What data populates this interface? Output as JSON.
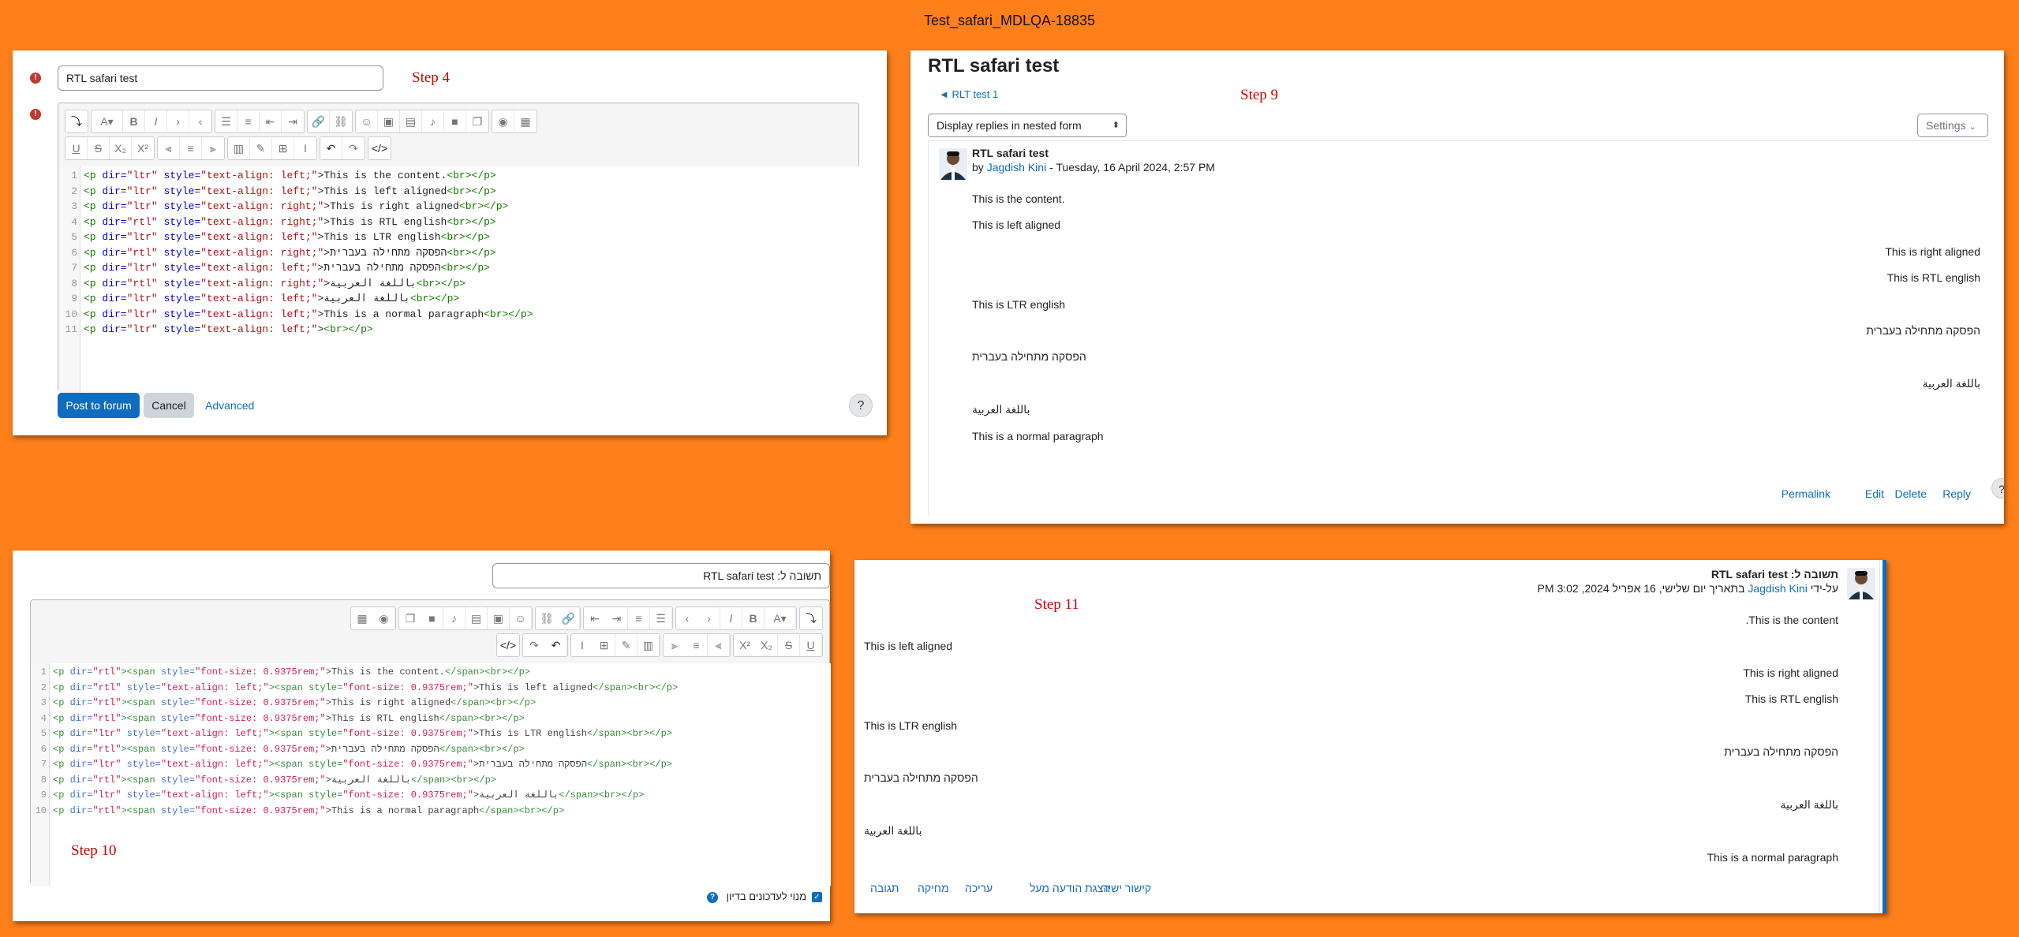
{
  "page_title": "Test_safari_MDLQA-18835",
  "steps": {
    "s4": "Step 4",
    "s9": "Step 9",
    "s10": "Step 10",
    "s11": "Step 11"
  },
  "panel1": {
    "subject_value": "RTL safari test",
    "code_lines": [
      [
        "<p ",
        "dir=",
        "\"ltr\"",
        " style=",
        "\"text-align: left;\"",
        ">This is the content.",
        "<br></p>"
      ],
      [
        "<p ",
        "dir=",
        "\"ltr\"",
        " style=",
        "\"text-align: left;\"",
        ">This is left aligned",
        "<br></p>"
      ],
      [
        "<p ",
        "dir=",
        "\"ltr\"",
        " style=",
        "\"text-align: right;\"",
        ">This is right aligned",
        "<br></p>"
      ],
      [
        "<p ",
        "dir=",
        "\"rtl\"",
        " style=",
        "\"text-align: right;\"",
        ">This is RTL english",
        "<br></p>"
      ],
      [
        "<p ",
        "dir=",
        "\"ltr\"",
        " style=",
        "\"text-align: left;\"",
        ">This is LTR english",
        "<br></p>"
      ],
      [
        "<p ",
        "dir=",
        "\"rtl\"",
        " style=",
        "\"text-align: right;\"",
        ">הפסקה מתחילה בעברית",
        "<br></p>"
      ],
      [
        "<p ",
        "dir=",
        "\"ltr\"",
        " style=",
        "\"text-align: left;\"",
        ">הפסקה מתחילה בעברית",
        "<br></p>"
      ],
      [
        "<p ",
        "dir=",
        "\"rtl\"",
        " style=",
        "\"text-align: right;\"",
        ">باللغة العربية",
        "<br></p>"
      ],
      [
        "<p ",
        "dir=",
        "\"ltr\"",
        " style=",
        "\"text-align: left;\"",
        ">باللغة العربية",
        "<br></p>"
      ],
      [
        "<p ",
        "dir=",
        "\"ltr\"",
        " style=",
        "\"text-align: left;\"",
        ">This is a normal paragraph",
        "<br></p>"
      ],
      [
        "<p ",
        "dir=",
        "\"ltr\"",
        " style=",
        "\"text-align: left;\"",
        ">",
        "<br></p>"
      ]
    ],
    "post_label": "Post to forum",
    "cancel_label": "Cancel",
    "advanced_label": "Advanced",
    "help_label": "?"
  },
  "panel2": {
    "heading": "RTL safari test",
    "back_link": "◄ RLT test 1",
    "display_select": "Display replies in nested form",
    "settings_label": "Settings",
    "post_title": "RTL safari test",
    "by_label": "by",
    "author": "Jagdish Kini",
    "date": " - Tuesday, 16 April 2024, 2:57 PM",
    "lines": [
      {
        "text": "This is the content.",
        "align": "left"
      },
      {
        "text": "This is left aligned",
        "align": "left"
      },
      {
        "text": "This is right aligned",
        "align": "right"
      },
      {
        "text": "This is RTL english",
        "align": "right"
      },
      {
        "text": "This is LTR english",
        "align": "left"
      },
      {
        "text": "הפסקה מתחילה בעברית",
        "align": "right"
      },
      {
        "text": "הפסקה מתחילה בעברית",
        "align": "left"
      },
      {
        "text": "باللغة العربية",
        "align": "right"
      },
      {
        "text": "باللغة العربية",
        "align": "left"
      },
      {
        "text": "This is a normal paragraph",
        "align": "left"
      }
    ],
    "actions": [
      "Permalink",
      "Edit",
      "Delete",
      "Reply"
    ],
    "help_label": "?"
  },
  "panel3": {
    "subject_value": "תשובה ל: RTL safari test",
    "code_lines": [
      [
        "<p ",
        "dir=",
        "\"rtl\"",
        "><span ",
        "style=",
        "\"font-size: 0.9375rem;\"",
        ">This is the content.",
        "</span><br></p>"
      ],
      [
        "<p ",
        "dir=",
        "\"rtl\"",
        " style=",
        "\"text-align: left;\"",
        "><span style=",
        "\"font-size: 0.9375rem;\"",
        ">This is left aligned",
        "</span><br></p>"
      ],
      [
        "<p ",
        "dir=",
        "\"rtl\"",
        "><span ",
        "style=",
        "\"font-size: 0.9375rem;\"",
        ">This is right aligned",
        "</span><br></p>"
      ],
      [
        "<p ",
        "dir=",
        "\"rtl\"",
        "><span ",
        "style=",
        "\"font-size: 0.9375rem;\"",
        ">This is RTL english",
        "</span><br></p>"
      ],
      [
        "<p ",
        "dir=",
        "\"ltr\"",
        " style=",
        "\"text-align: left;\"",
        "><span style=",
        "\"font-size: 0.9375rem;\"",
        ">This is LTR english",
        "</span><br></p>"
      ],
      [
        "<p ",
        "dir=",
        "\"rtl\"",
        "><span ",
        "style=",
        "\"font-size: 0.9375rem;\"",
        ">הפסקה מתחילה בעברית",
        "</span><br></p>"
      ],
      [
        "<p ",
        "dir=",
        "\"ltr\"",
        " style=",
        "\"text-align: left;\"",
        "><span style=",
        "\"font-size: 0.9375rem;\"",
        ">הפסקה מתחילה בעברית",
        "</span><br></p>"
      ],
      [
        "<p ",
        "dir=",
        "\"rtl\"",
        "><span ",
        "style=",
        "\"font-size: 0.9375rem;\"",
        ">باللغة العربية",
        "</span><br></p>"
      ],
      [
        "<p ",
        "dir=",
        "\"ltr\"",
        " style=",
        "\"text-align: left;\"",
        "><span style=",
        "\"font-size: 0.9375rem;\"",
        ">باللغة العربية",
        "</span><br></p>"
      ],
      [
        "<p ",
        "dir=",
        "\"rtl\"",
        "><span ",
        "style=",
        "\"font-size: 0.9375rem;\"",
        ">This is a normal paragraph",
        "</span><br></p>"
      ]
    ],
    "subscribe_label": "מנוי לעדכונים בדיון"
  },
  "panel4": {
    "post_title": "תשובה ל: RTL safari test",
    "by_prefix": "על-ידי ",
    "author": "Jagdish Kini",
    "date": " בתאריך יום שלישי, 16 אפריל 2024, 3:02 PM",
    "lines": [
      {
        "text": "This is the content.",
        "align": "right"
      },
      {
        "text": "This is left aligned",
        "align": "left"
      },
      {
        "text": "This is right aligned",
        "align": "right"
      },
      {
        "text": "This is RTL english",
        "align": "right"
      },
      {
        "text": "This is LTR english",
        "align": "left"
      },
      {
        "text": "הפסקה מתחילה בעברית",
        "align": "right"
      },
      {
        "text": "הפסקה מתחילה בעברית",
        "align": "left"
      },
      {
        "text": "باللغة العربية",
        "align": "right"
      },
      {
        "text": "باللغة العربية",
        "align": "left"
      },
      {
        "text": "This is a normal paragraph",
        "align": "right"
      }
    ],
    "actions": [
      "קישור ישיר",
      "הצגת הודעה מעל",
      "עריכה",
      "מחיקה",
      "תגובה"
    ]
  }
}
